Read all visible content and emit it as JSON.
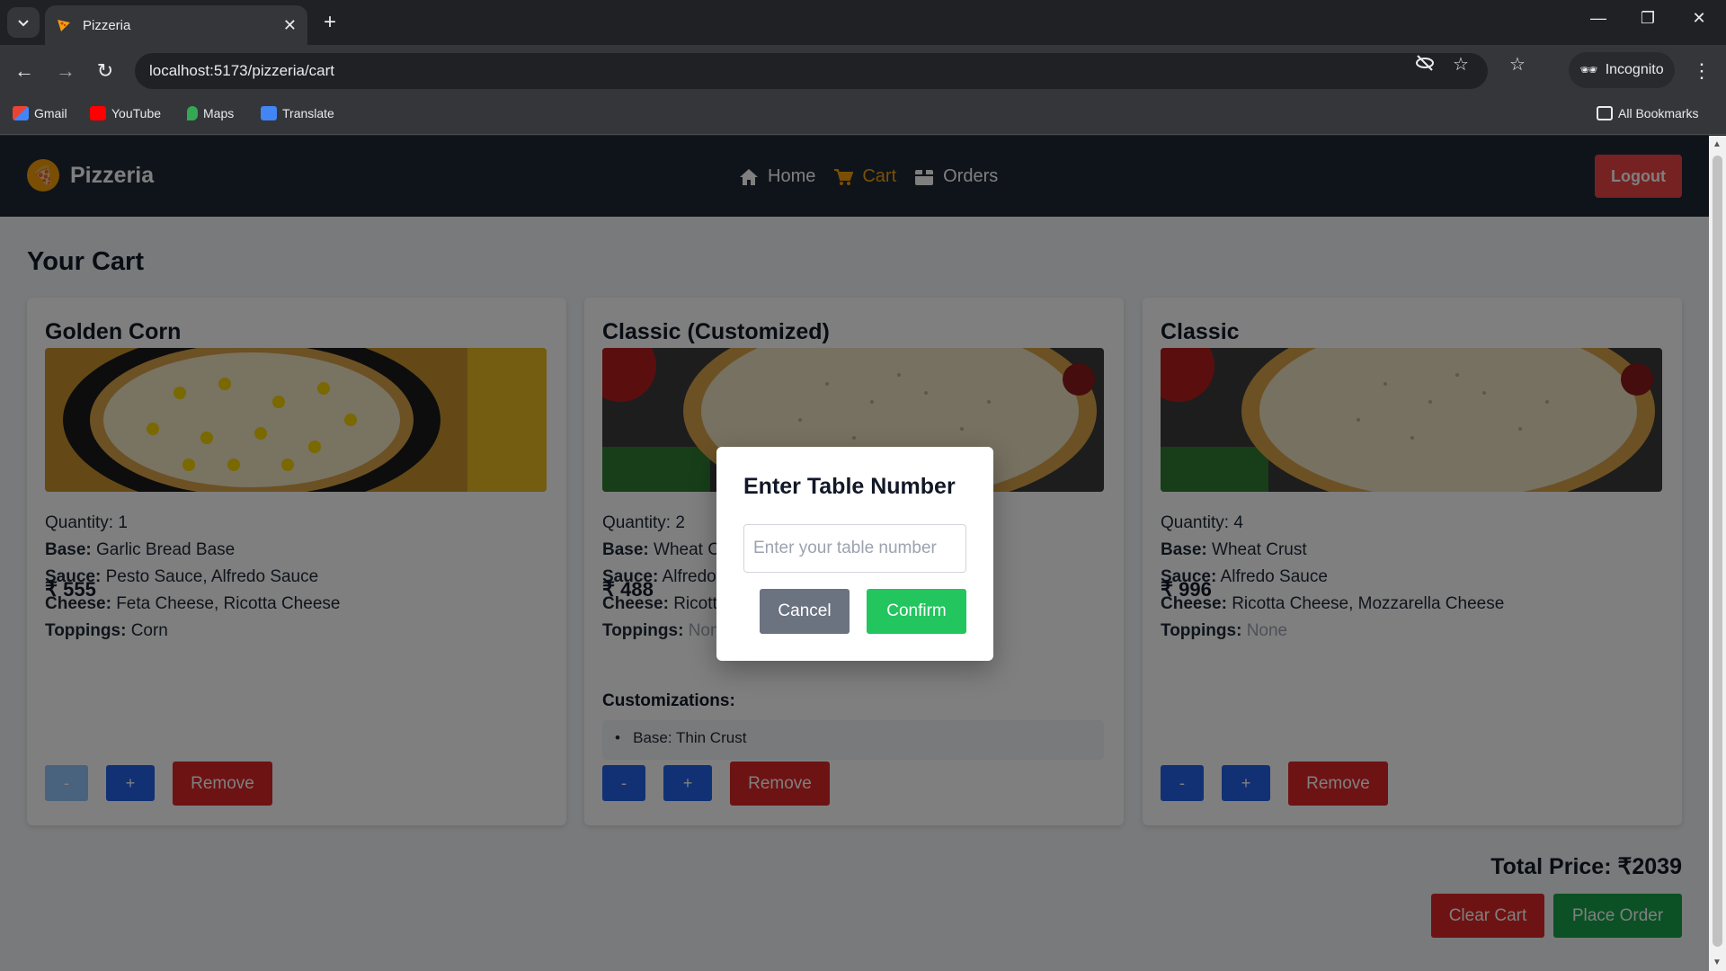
{
  "browser": {
    "tab_title": "Pizzeria",
    "url": "localhost:5173/pizzeria/cart",
    "incognito_label": "Incognito",
    "bookmarks": [
      "Gmail",
      "YouTube",
      "Maps",
      "Translate"
    ],
    "all_bookmarks": "All Bookmarks"
  },
  "navbar": {
    "brand": "Pizzeria",
    "links": [
      {
        "label": "Home",
        "active": false
      },
      {
        "label": "Cart",
        "active": true
      },
      {
        "label": "Orders",
        "active": false
      }
    ],
    "logout": "Logout"
  },
  "page": {
    "title": "Your Cart",
    "labels": {
      "base": "Base:",
      "sauce": "Sauce:",
      "cheese": "Cheese:",
      "toppings": "Toppings:",
      "remove": "Remove",
      "minus": "-",
      "plus": "+"
    }
  },
  "cart": [
    {
      "name": "Golden Corn",
      "quantity": "Quantity: 1",
      "base": "Garlic Bread Base",
      "sauce": "Pesto Sauce, Alfredo Sauce",
      "cheese": "Feta Cheese, Ricotta Cheese",
      "toppings": "Corn",
      "price": "₹ 555"
    },
    {
      "name": "Classic (Customized)",
      "quantity": "Quantity: 2",
      "base": "Wheat Crust",
      "sauce": "Alfredo Sauce",
      "cheese": "Ricotta Cheese, Mozzarella Cheese",
      "toppings": "None",
      "price": "₹ 488",
      "customizations_title": "Customizations:",
      "customizations": [
        "Base: Thin Crust"
      ]
    },
    {
      "name": "Classic",
      "quantity": "Quantity: 4",
      "base": "Wheat Crust",
      "sauce": "Alfredo Sauce",
      "cheese": "Ricotta Cheese, Mozzarella Cheese",
      "toppings": "None",
      "price": "₹ 996"
    }
  ],
  "footer": {
    "total": "Total Price: ₹2039",
    "clear": "Clear Cart",
    "place": "Place Order"
  },
  "modal": {
    "title": "Enter Table Number",
    "placeholder": "Enter your table number",
    "cancel": "Cancel",
    "confirm": "Confirm"
  },
  "colors": {
    "navbar": "#1f2937",
    "accent": "#f59e0b",
    "danger": "#dc2626",
    "primary": "#2563eb",
    "success": "#16a34a"
  }
}
